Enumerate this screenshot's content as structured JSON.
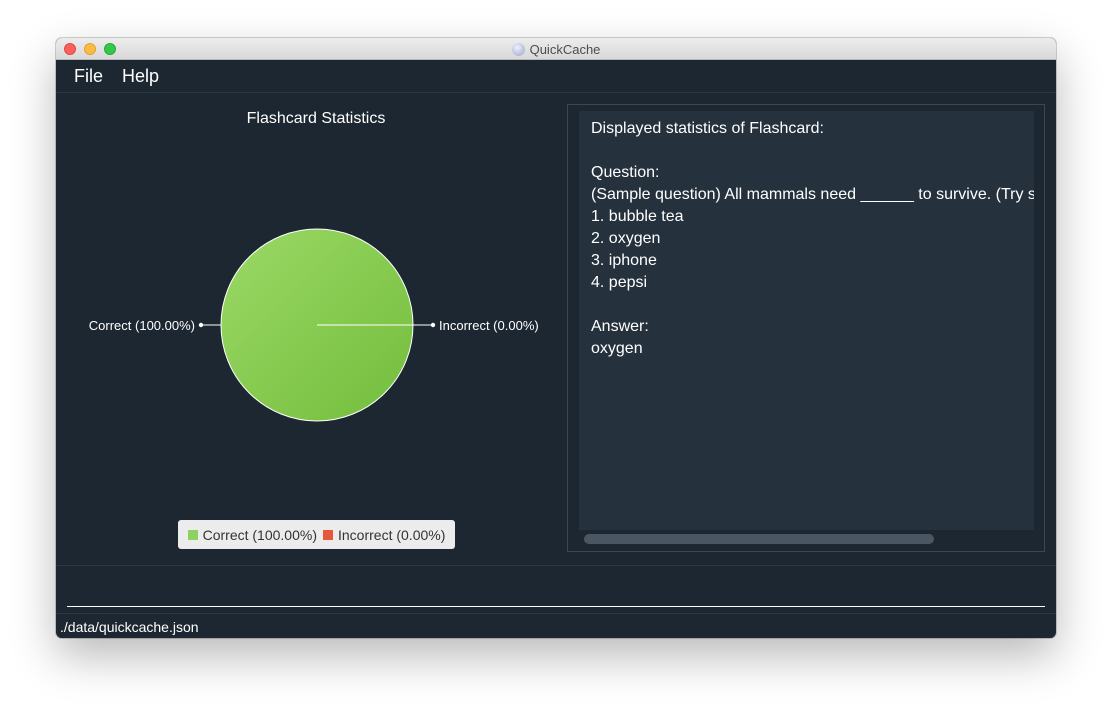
{
  "window": {
    "title": "QuickCache"
  },
  "menu": {
    "file": "File",
    "help": "Help"
  },
  "chart_data": {
    "type": "pie",
    "title": "Flashcard Statistics",
    "slices": [
      {
        "label": "Correct (100.00%)",
        "value": 100.0,
        "color": "#8ed160"
      },
      {
        "label": "Incorrect (0.00%)",
        "value": 0.0,
        "color": "#e8573a"
      }
    ],
    "legend": {
      "position": "bottom",
      "entries": [
        "Correct (100.00%)",
        "Incorrect (0.00%)"
      ]
    }
  },
  "stats": {
    "heading": "Displayed statistics of Flashcard:",
    "question_label": "Question:",
    "question_text": "(Sample question) All mammals need ______ to survive. (Try sa",
    "options": [
      "1. bubble tea",
      "2. oxygen",
      "3. iphone",
      "4. pepsi"
    ],
    "answer_label": "Answer:",
    "answer_text": "oxygen"
  },
  "command_box": {
    "value": "",
    "placeholder": ""
  },
  "status_bar": {
    "path": "./data/quickcache.json"
  },
  "colors": {
    "background": "#1d2731",
    "panel": "#25313c",
    "correct": "#8ed160",
    "incorrect": "#e8573a"
  }
}
